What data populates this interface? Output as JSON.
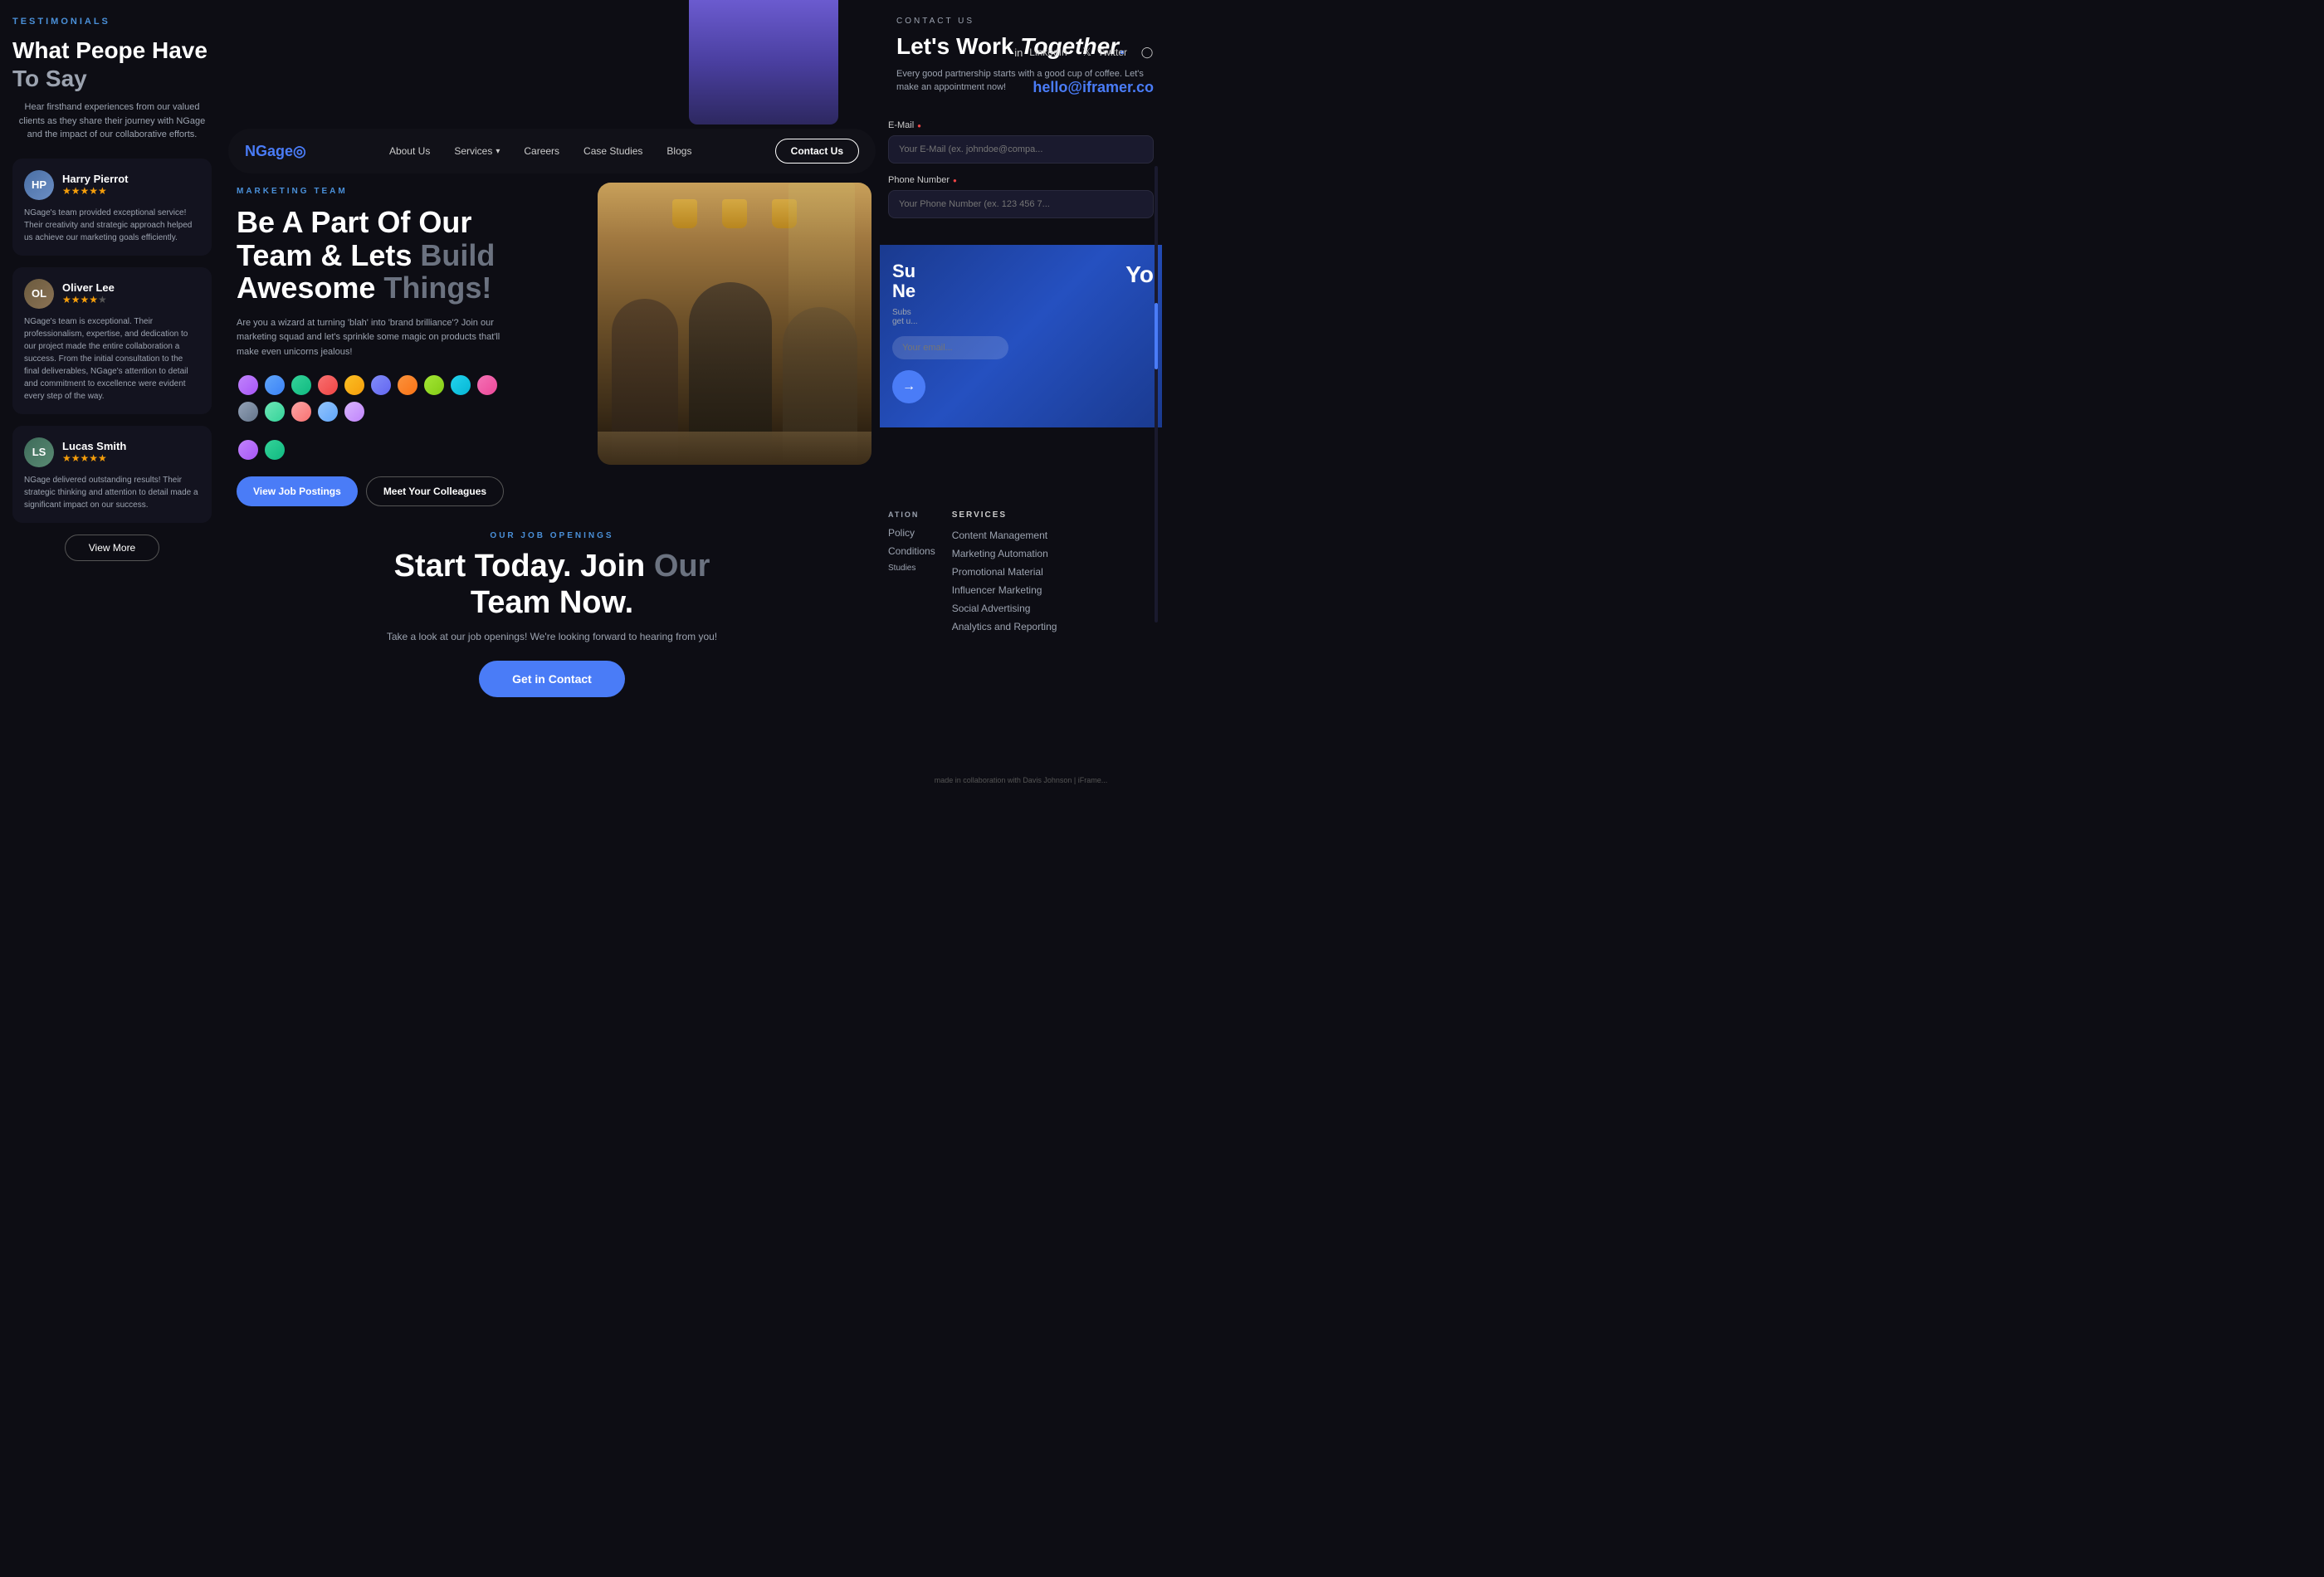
{
  "site": {
    "name": "NGage",
    "logo_accent": "◎"
  },
  "testimonials": {
    "label": "TESTIMONIALS",
    "title_part1": "What Peope Have ",
    "title_part2": "To Say",
    "subtitle": "Hear firsthand experiences from our valued clients as they share their journey with NGage and the impact of our collaborative efforts.",
    "view_more_label": "View More",
    "reviews": [
      {
        "name": "Harry Pierrot",
        "stars": "★★★★★",
        "initials": "HP",
        "text": "NGage's team provided exceptional service! Their creativity and strategic approach helped us achieve our marketing goals efficiently."
      },
      {
        "name": "Oliver Lee",
        "stars": "★★★★",
        "initials": "OL",
        "text": "NGage's team is exceptional. Their professionalism, expertise, and dedication to our project made the entire collaboration a success. From the initial consultation to the final deliverables, NGage's attention to detail and commitment to excellence were evident every step of the way."
      },
      {
        "name": "Lucas Smith",
        "stars": "★★★★★",
        "initials": "LS",
        "text": "NGage delivered outstanding results! Their strategic thinking and attention to detail made a significant impact on our success."
      }
    ]
  },
  "navbar": {
    "logo": "NGage",
    "links": [
      "About Us",
      "Services",
      "Careers",
      "Case Studies",
      "Blogs"
    ],
    "contact_btn": "Contact Us"
  },
  "marketing": {
    "tag": "MARKETING TEAM",
    "title_part1": "Be A Part Of Our Team & Lets ",
    "title_part2": "Build",
    "title_part3": " Awesome ",
    "title_part4": "Things!",
    "description": "Are you a wizard at turning 'blah' into 'brand brilliance'? Join our marketing squad and let's sprinkle some magic on products that'll make even unicorns jealous!",
    "view_jobs_btn": "View Job Postings",
    "meet_colleagues_btn": "Meet Your Colleagues"
  },
  "jobs": {
    "tag": "OUR JOB OPENINGS",
    "title_part1": "Start Today. Join ",
    "title_part2": "Our",
    "title_part3": " Team Now.",
    "description": "Take a look at our job openings! We're looking forward to hearing from you!",
    "cta_btn": "Get in Contact"
  },
  "contact": {
    "label": "CONTACT US",
    "title": "Let's Work Together.",
    "subtitle": "Every good partnership starts with a good cup of coffee. Let's make an appointment now!",
    "email": "hello@iframer.co",
    "social": {
      "linkedin": "LinkedIn",
      "twitter": "Twitter"
    },
    "form": {
      "email_label": "E-Mail",
      "email_placeholder": "Your E-Mail (ex. johndoe@compa...",
      "phone_label": "Phone Number",
      "phone_placeholder": "Your Phone Number (ex. 123 456 7..."
    }
  },
  "services_footer": {
    "label": "SERVICES",
    "items": [
      "Content Management",
      "Marketing Automation",
      "Promotional Material",
      "Influencer Marketing",
      "Social Advertising",
      "Analytics and Reporting"
    ]
  },
  "footer": {
    "policy": "Policy",
    "conditions": "Conditions",
    "case_studies": "Studies",
    "made_by": "made in collaboration with Davis Johnson | iFrame..."
  },
  "subscribe": {
    "title": "Su Ne",
    "subtitle": "Subs get u...",
    "yo_text": "Yo"
  },
  "colors": {
    "accent_blue": "#4a7cf7",
    "dark_bg": "#0d0d14",
    "card_bg": "#13131f",
    "text_gray": "#9ca3b0",
    "star_gold": "#f59e0b"
  }
}
